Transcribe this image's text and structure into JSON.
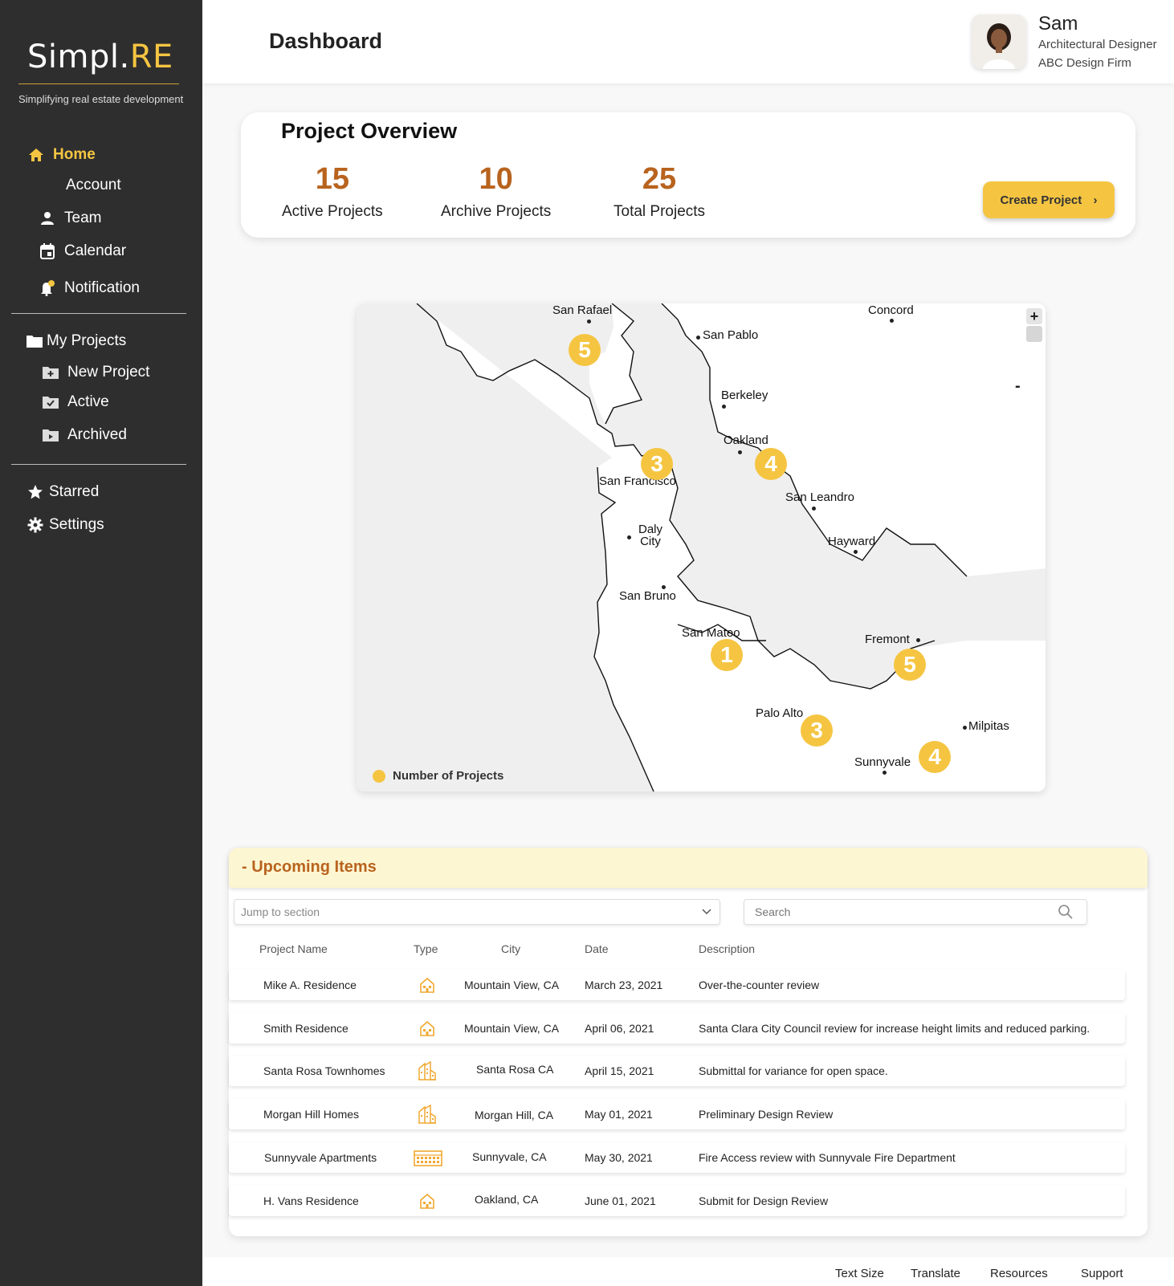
{
  "brand": {
    "name_main": "Simpl.",
    "name_accent": "RE",
    "tagline": "Simplifying real estate development"
  },
  "sidebar": {
    "items": [
      {
        "label": "Home",
        "icon": "home-icon"
      },
      {
        "label": "Account"
      },
      {
        "label": "Team",
        "icon": "person-icon"
      },
      {
        "label": "Calendar",
        "icon": "calendar-icon"
      },
      {
        "label": "Notification",
        "icon": "bell-icon"
      },
      {
        "label": "My Projects",
        "icon": "folder-icon"
      },
      {
        "label": "New Project",
        "icon": "folder-plus-icon"
      },
      {
        "label": "Active",
        "icon": "folder-check-icon"
      },
      {
        "label": "Archived",
        "icon": "folder-archive-icon"
      },
      {
        "label": "Starred",
        "icon": "star-icon"
      },
      {
        "label": "Settings",
        "icon": "gear-icon"
      }
    ]
  },
  "header": {
    "title": "Dashboard",
    "user": {
      "name": "Sam",
      "role": "Architectural Designer",
      "firm": "ABC Design Firm"
    }
  },
  "overview": {
    "title": "Project Overview",
    "stats": [
      {
        "value": "15",
        "label": "Active Projects"
      },
      {
        "value": "10",
        "label": "Archive Projects"
      },
      {
        "value": "25",
        "label": "Total Projects"
      }
    ],
    "create_label": "Create Project"
  },
  "map": {
    "cities": [
      "San Rafael",
      "San Pablo",
      "Concord",
      "Berkeley",
      "Oakland",
      "San Francisco",
      "San Leandro",
      "Daly City",
      "Hayward",
      "San Bruno",
      "San Mateo",
      "Fremont",
      "Palo Alto",
      "Milpitas",
      "Sunnyvale"
    ],
    "markers": [
      "5",
      "3",
      "4",
      "1",
      "5",
      "3",
      "4"
    ],
    "zoom_in": "+",
    "zoom_out": "-",
    "legend": "Number of Projects"
  },
  "upcoming": {
    "title": "- Upcoming Items",
    "jump_placeholder": "Jump to section",
    "search_placeholder": "Search",
    "columns": [
      "Project Name",
      "Type",
      "City",
      "Date",
      "Description"
    ],
    "rows": [
      {
        "name": "Mike A. Residence",
        "type": "house-icon",
        "city": "Mountain View, CA",
        "date": "March 23, 2021",
        "description": "Over-the-counter review"
      },
      {
        "name": "Smith Residence",
        "type": "house-icon",
        "city": "Mountain View, CA",
        "date": "April 06, 2021",
        "description": "Santa Clara City Council review for increase height limits and reduced parking."
      },
      {
        "name": "Santa Rosa Townhomes",
        "type": "townhome-icon",
        "city": "Santa Rosa CA",
        "date": "April 15, 2021",
        "description": "Submittal for variance for open space."
      },
      {
        "name": "Morgan Hill Homes",
        "type": "townhome-icon",
        "city": "Morgan Hill, CA",
        "date": "May 01, 2021",
        "description": "Preliminary Design Review"
      },
      {
        "name": "Sunnyvale Apartments",
        "type": "apartment-icon",
        "city": "Sunnyvale, CA",
        "date": "May 30, 2021",
        "description": "Fire Access review with Sunnyvale Fire Department"
      },
      {
        "name": "H. Vans Residence",
        "type": "house-icon",
        "city": "Oakland, CA",
        "date": "June 01, 2021",
        "description": "Submit for Design Review"
      }
    ]
  },
  "footer": {
    "links": [
      "Text Size",
      "Translate",
      "Resources",
      "Support"
    ]
  },
  "colors": {
    "accent": "#f5c542",
    "brand_orange": "#b8631e",
    "sidebar_bg": "#2e2e2e"
  }
}
